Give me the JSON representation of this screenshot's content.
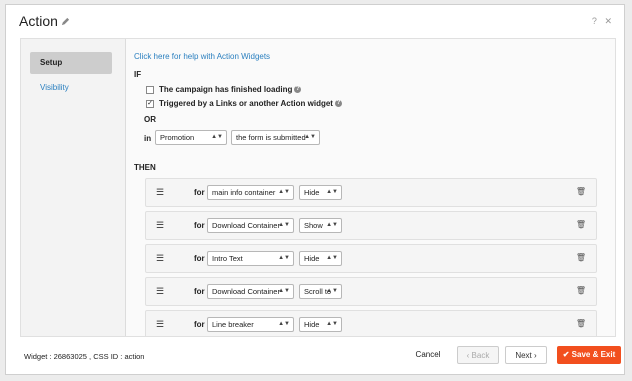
{
  "dialog": {
    "title": "Action",
    "help_icon": "question-icon",
    "close_icon": "close-icon"
  },
  "sidebar": {
    "items": [
      {
        "label": "Setup"
      },
      {
        "label": "Visibility"
      }
    ]
  },
  "content": {
    "help_link": "Click here for help with Action Widgets",
    "if_label": "IF",
    "conditions": [
      {
        "label": "The campaign has finished loading",
        "checked": false
      },
      {
        "label": "Triggered by a Links or another Action widget",
        "checked": true
      }
    ],
    "or_label": "OR",
    "in_label": "in",
    "in_select": "Promotion",
    "event_select": "the form is submitted",
    "then_label": "THEN",
    "actions": [
      {
        "for_label": "for",
        "target": "main info container",
        "action": "Hide"
      },
      {
        "for_label": "for",
        "target": "Download Container",
        "action": "Show"
      },
      {
        "for_label": "for",
        "target": "Intro Text",
        "action": "Hide"
      },
      {
        "for_label": "for",
        "target": "Download Container",
        "action": "Scroll to"
      },
      {
        "for_label": "for",
        "target": "Line breaker",
        "action": "Hide"
      }
    ]
  },
  "footer": {
    "widget_info": "Widget : 26863025 , CSS ID : action",
    "cancel": "Cancel",
    "back": "‹ Back",
    "next": "Next ›",
    "save": "Save & Exit"
  }
}
